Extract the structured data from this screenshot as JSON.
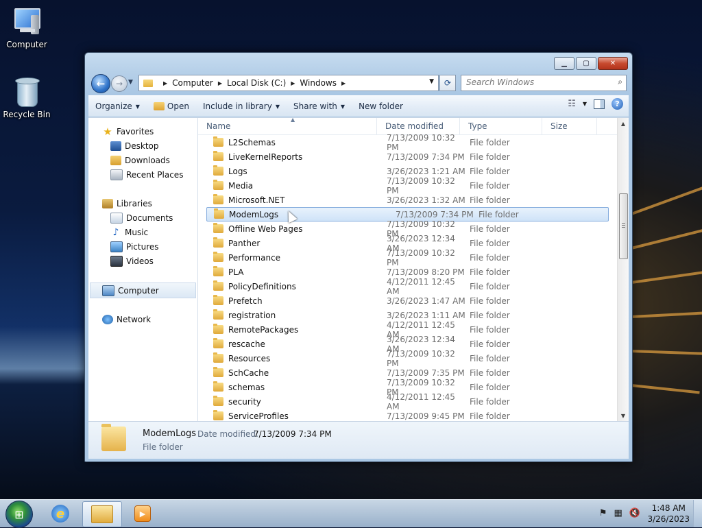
{
  "desktop": {
    "icons": [
      {
        "label": "Computer",
        "icon": "computer-icon"
      },
      {
        "label": "Recycle Bin",
        "icon": "recycle-bin-icon"
      }
    ]
  },
  "window": {
    "address": {
      "crumbs": [
        "Computer",
        "Local Disk (C:)",
        "Windows"
      ]
    },
    "search_placeholder": "Search Windows",
    "toolbar": {
      "organize": "Organize",
      "open": "Open",
      "include_in_library": "Include in library",
      "share_with": "Share with",
      "new_folder": "New folder"
    },
    "nav": {
      "favorites": "Favorites",
      "favorites_items": [
        "Desktop",
        "Downloads",
        "Recent Places"
      ],
      "libraries": "Libraries",
      "libraries_items": [
        "Documents",
        "Music",
        "Pictures",
        "Videos"
      ],
      "computer": "Computer",
      "network": "Network"
    },
    "columns": {
      "name": "Name",
      "date": "Date modified",
      "type": "Type",
      "size": "Size"
    },
    "files": [
      {
        "name": "L2Schemas",
        "date": "7/13/2009 10:32 PM",
        "type": "File folder"
      },
      {
        "name": "LiveKernelReports",
        "date": "7/13/2009 7:34 PM",
        "type": "File folder"
      },
      {
        "name": "Logs",
        "date": "3/26/2023 1:21 AM",
        "type": "File folder"
      },
      {
        "name": "Media",
        "date": "7/13/2009 10:32 PM",
        "type": "File folder"
      },
      {
        "name": "Microsoft.NET",
        "date": "3/26/2023 1:32 AM",
        "type": "File folder"
      },
      {
        "name": "ModemLogs",
        "date": "7/13/2009 7:34 PM",
        "type": "File folder"
      },
      {
        "name": "Offline Web Pages",
        "date": "7/13/2009 10:32 PM",
        "type": "File folder"
      },
      {
        "name": "Panther",
        "date": "3/26/2023 12:34 AM",
        "type": "File folder"
      },
      {
        "name": "Performance",
        "date": "7/13/2009 10:32 PM",
        "type": "File folder"
      },
      {
        "name": "PLA",
        "date": "7/13/2009 8:20 PM",
        "type": "File folder"
      },
      {
        "name": "PolicyDefinitions",
        "date": "4/12/2011 12:45 AM",
        "type": "File folder"
      },
      {
        "name": "Prefetch",
        "date": "3/26/2023 1:47 AM",
        "type": "File folder"
      },
      {
        "name": "registration",
        "date": "3/26/2023 1:11 AM",
        "type": "File folder"
      },
      {
        "name": "RemotePackages",
        "date": "4/12/2011 12:45 AM",
        "type": "File folder"
      },
      {
        "name": "rescache",
        "date": "3/26/2023 12:34 AM",
        "type": "File folder"
      },
      {
        "name": "Resources",
        "date": "7/13/2009 10:32 PM",
        "type": "File folder"
      },
      {
        "name": "SchCache",
        "date": "7/13/2009 7:35 PM",
        "type": "File folder"
      },
      {
        "name": "schemas",
        "date": "7/13/2009 10:32 PM",
        "type": "File folder"
      },
      {
        "name": "security",
        "date": "4/12/2011 12:45 AM",
        "type": "File folder"
      },
      {
        "name": "ServiceProfiles",
        "date": "7/13/2009 9:45 PM",
        "type": "File folder"
      }
    ],
    "selected_index": 5,
    "details": {
      "name": "ModemLogs",
      "modified_label": "Date modified:",
      "modified_value": "7/13/2009 7:34 PM",
      "type": "File folder"
    }
  },
  "taskbar": {
    "time": "1:48 AM",
    "date": "3/26/2023"
  }
}
